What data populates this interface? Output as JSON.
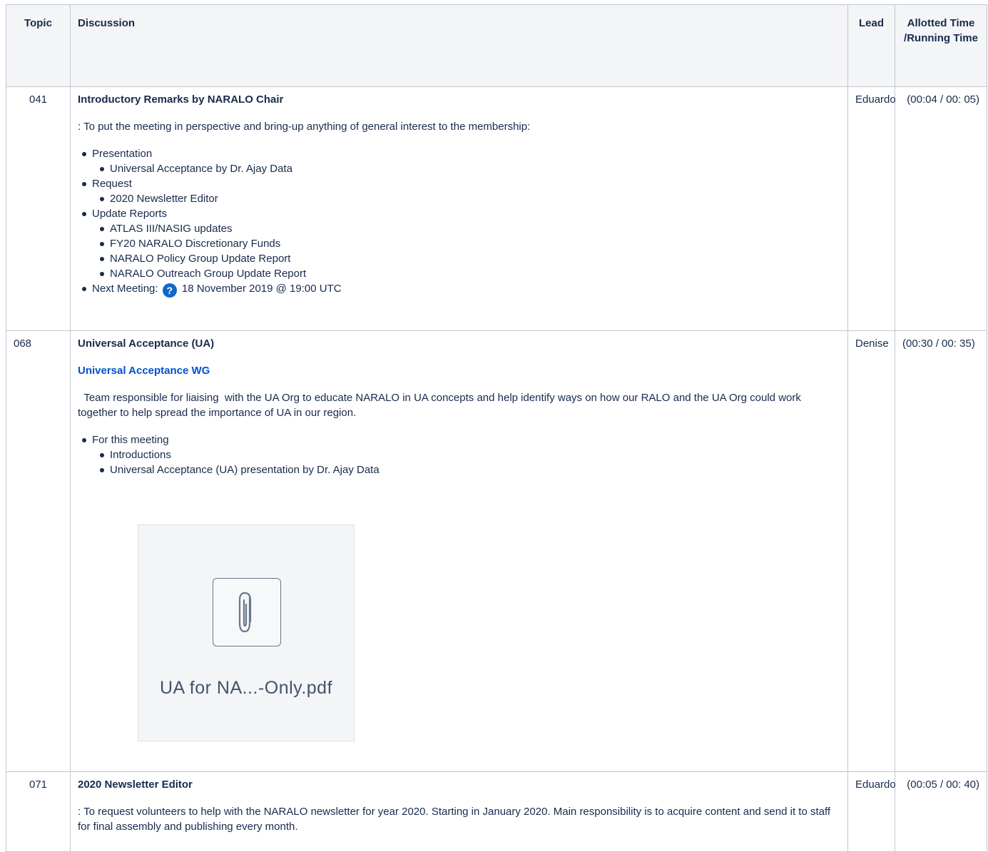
{
  "headers": {
    "topic": "Topic",
    "discussion": "Discussion",
    "lead": "Lead",
    "time": "Allotted Time /Running Time"
  },
  "rows": [
    {
      "topic": "041",
      "title": "Introductory Remarks by NARALO Chair",
      "intro": ": To put the meeting in perspective  and bring-up anything of general interest to the membership:",
      "items": [
        {
          "label": "Presentation",
          "sub": [
            "Universal Acceptance by Dr. Ajay Data"
          ]
        },
        {
          "label": "Request",
          "sub": [
            "2020 Newsletter Editor"
          ]
        },
        {
          "label": "Update Reports",
          "sub": [
            "ATLAS III/NASIG updates",
            "FY20 NARALO Discretionary Funds",
            "NARALO Policy Group Update Report",
            "NARALO Outreach Group Update Report"
          ]
        },
        {
          "label": "Next Meeting:",
          "suffix": "18 November 2019 @ 19:00 UTC",
          "icon": "question-circle-icon",
          "icon_glyph": "?"
        }
      ],
      "lead": "Eduardo",
      "time": "(00:04 / 00: 05)"
    },
    {
      "topic": "068",
      "title": "Universal Acceptance (UA)",
      "link": "Universal Acceptance WG",
      "intro": "  Team responsible for liaising  with the UA Org to educate NARALO in UA concepts and help identify ways on how our RALO and the UA Org could work together to help spread the importance of UA in our region.",
      "items": [
        {
          "label": "For this meeting",
          "sub": [
            "Introductions",
            "Universal Acceptance (UA) presentation by Dr. Ajay Data"
          ]
        }
      ],
      "attachment": {
        "icon": "paperclip-icon",
        "filename": "UA for NA...-Only.pdf"
      },
      "lead": "Denise",
      "time": "(00:30 / 00: 35)"
    },
    {
      "topic": "071",
      "title": "2020 Newsletter Editor",
      "intro": ": To request volunteers to help with the NARALO newsletter for year 2020. Starting in January 2020. Main responsibility is to acquire content and send it to staff for final assembly and publishing every month.",
      "lead": "Eduardo",
      "time": "(00:05 / 00: 40)"
    }
  ]
}
